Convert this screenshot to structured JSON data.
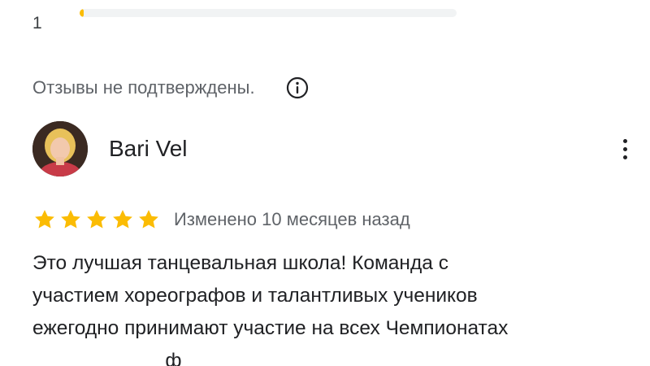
{
  "rating_row": {
    "number": "1",
    "fill_fraction": 0.01,
    "fill_color": "#fbbc04",
    "track_color": "#f1f3f4"
  },
  "notice": {
    "text": "Отзывы не подтверждены.",
    "icon": "info-icon"
  },
  "review": {
    "author": "Bari Vel",
    "avatar": "avatar-photo",
    "menu_icon": "more-vert-icon",
    "stars": 5,
    "star_color": "#fbbc04",
    "edited": "Изменено 10 месяцев назад",
    "lines": [
      "Это лучшая танцевальная школа! Команда с",
      "участием хореографов и талантливых учеников",
      "ежегодно принимают участие на всех Чемпионатах",
      "                        ф"
    ]
  }
}
